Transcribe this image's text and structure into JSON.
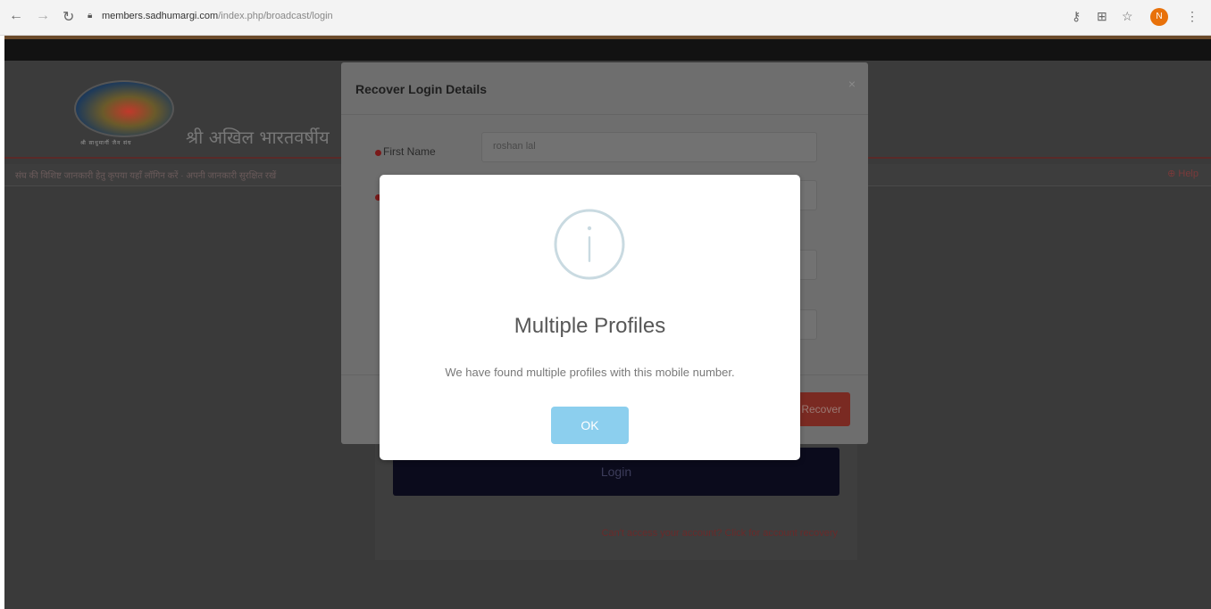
{
  "browser": {
    "url_domain": "members.sadhumargi.com",
    "url_path": "/index.php/broadcast/login",
    "avatar_initial": "N"
  },
  "page": {
    "site_title": "श्री अखिल भारतवर्षीय",
    "logo_caption": "श्री साधुमार्गी जैन संघ",
    "marquee_text": "संघ की विशिष्ट जानकारी हेतु कृपया यहाँ लॉगिन करें · अपनी जानकारी सुरक्षित रखें",
    "help_label": "Help",
    "login_label": "Login",
    "recovery_link": "Can't access your account? Click for account recovery"
  },
  "recover_modal": {
    "title": "Recover Login Details",
    "close_label": "×",
    "first_name_label": "First Name",
    "first_name_value": "roshan lal",
    "recover_button": "Recover"
  },
  "alert": {
    "title": "Multiple Profiles",
    "message": "We have found multiple profiles with this mobile number.",
    "ok_label": "OK"
  },
  "colors": {
    "ok_button": "#8ccfee",
    "info_icon": "#c9dae1",
    "overlay": "#3a3a3a"
  }
}
